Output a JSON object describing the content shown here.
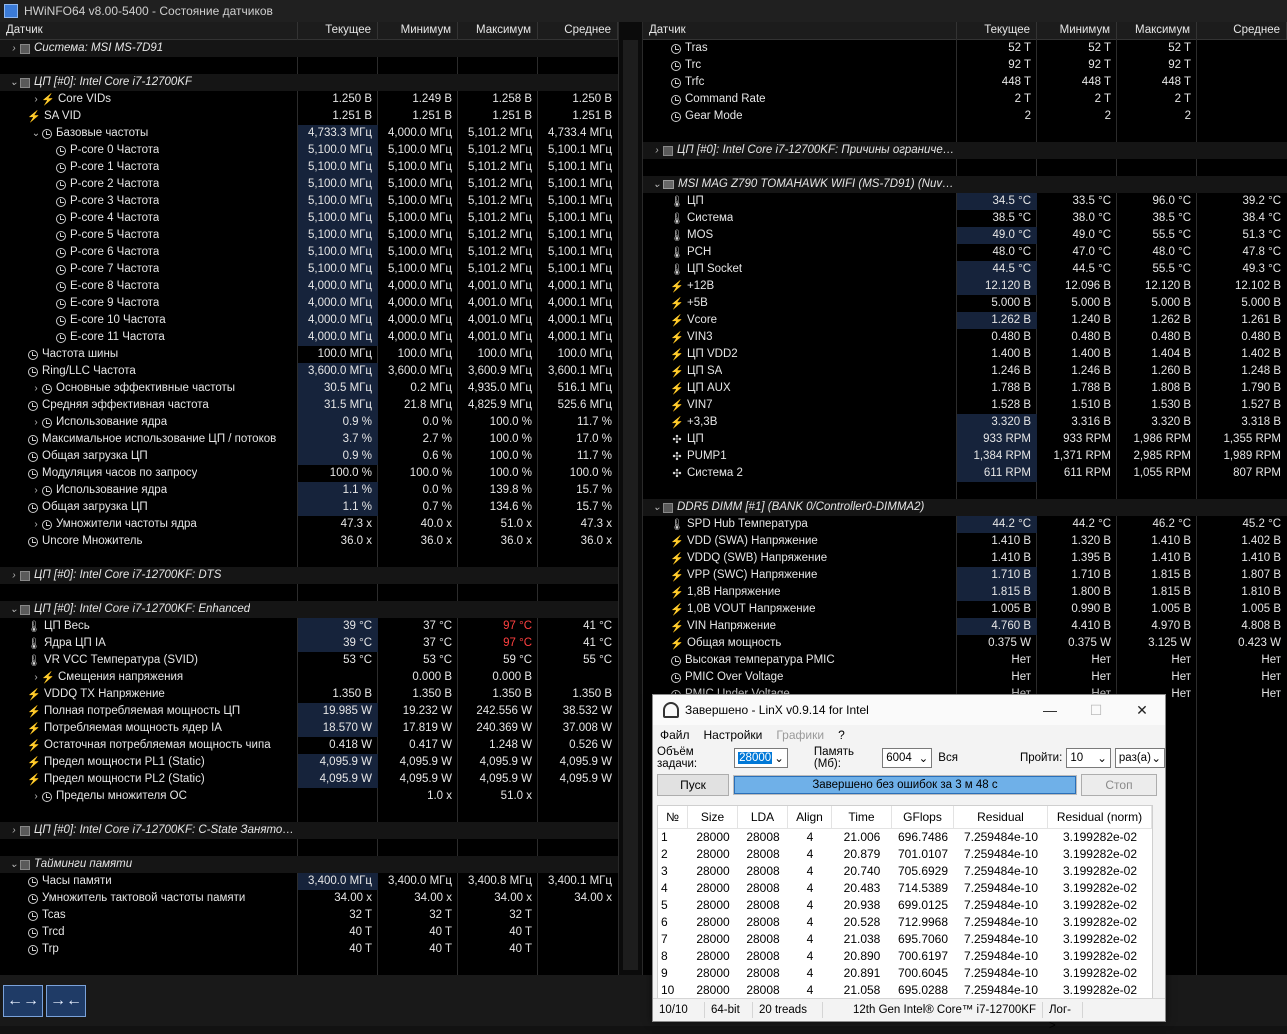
{
  "window_title": "HWiNFO64 v8.00-5400 - Состояние датчиков",
  "columns": {
    "sensor": "Датчик",
    "current": "Текущее",
    "min": "Минимум",
    "max": "Максимум",
    "avg": "Среднее"
  },
  "left_rows": [
    {
      "t": "g",
      "exp": "›",
      "icon": "chip",
      "name": "Система: MSI MS-7D91"
    },
    {
      "t": "s"
    },
    {
      "t": "g",
      "exp": "⌄",
      "icon": "chip",
      "name": "ЦП [#0]: Intel Core i7-12700KF"
    },
    {
      "t": "r",
      "ind": 1,
      "exp": "›",
      "icon": "bolt",
      "name": "Core VIDs",
      "cur": "1.250 В",
      "min": "1.249 В",
      "max": "1.258 В",
      "avg": "1.250 В"
    },
    {
      "t": "r",
      "ind": 0,
      "icon": "bolt",
      "name": "SA VID",
      "cur": "1.251 В",
      "min": "1.251 В",
      "max": "1.251 В",
      "avg": "1.251 В"
    },
    {
      "t": "r",
      "ind": 1,
      "exp": "⌄",
      "icon": "clock",
      "name": "Базовые частоты",
      "cur": "4,733.3 МГц",
      "min": "4,000.0 МГц",
      "max": "5,101.2 МГц",
      "avg": "4,733.4 МГц",
      "hl": true
    },
    {
      "t": "r",
      "ind": 2,
      "icon": "clock",
      "name": "P-core 0 Частота",
      "cur": "5,100.0 МГц",
      "min": "5,100.0 МГц",
      "max": "5,101.2 МГц",
      "avg": "5,100.1 МГц",
      "hl": true
    },
    {
      "t": "r",
      "ind": 2,
      "icon": "clock",
      "name": "P-core 1 Частота",
      "cur": "5,100.0 МГц",
      "min": "5,100.0 МГц",
      "max": "5,101.2 МГц",
      "avg": "5,100.1 МГц",
      "hl": true
    },
    {
      "t": "r",
      "ind": 2,
      "icon": "clock",
      "name": "P-core 2 Частота",
      "cur": "5,100.0 МГц",
      "min": "5,100.0 МГц",
      "max": "5,101.2 МГц",
      "avg": "5,100.1 МГц",
      "hl": true
    },
    {
      "t": "r",
      "ind": 2,
      "icon": "clock",
      "name": "P-core 3 Частота",
      "cur": "5,100.0 МГц",
      "min": "5,100.0 МГц",
      "max": "5,101.2 МГц",
      "avg": "5,100.1 МГц",
      "hl": true
    },
    {
      "t": "r",
      "ind": 2,
      "icon": "clock",
      "name": "P-core 4 Частота",
      "cur": "5,100.0 МГц",
      "min": "5,100.0 МГц",
      "max": "5,101.2 МГц",
      "avg": "5,100.1 МГц",
      "hl": true
    },
    {
      "t": "r",
      "ind": 2,
      "icon": "clock",
      "name": "P-core 5 Частота",
      "cur": "5,100.0 МГц",
      "min": "5,100.0 МГц",
      "max": "5,101.2 МГц",
      "avg": "5,100.1 МГц",
      "hl": true
    },
    {
      "t": "r",
      "ind": 2,
      "icon": "clock",
      "name": "P-core 6 Частота",
      "cur": "5,100.0 МГц",
      "min": "5,100.0 МГц",
      "max": "5,101.2 МГц",
      "avg": "5,100.1 МГц",
      "hl": true
    },
    {
      "t": "r",
      "ind": 2,
      "icon": "clock",
      "name": "P-core 7 Частота",
      "cur": "5,100.0 МГц",
      "min": "5,100.0 МГц",
      "max": "5,101.2 МГц",
      "avg": "5,100.1 МГц",
      "hl": true
    },
    {
      "t": "r",
      "ind": 2,
      "icon": "clock",
      "name": "E-core 8 Частота",
      "cur": "4,000.0 МГц",
      "min": "4,000.0 МГц",
      "max": "4,001.0 МГц",
      "avg": "4,000.1 МГц",
      "hl": true
    },
    {
      "t": "r",
      "ind": 2,
      "icon": "clock",
      "name": "E-core 9 Частота",
      "cur": "4,000.0 МГц",
      "min": "4,000.0 МГц",
      "max": "4,001.0 МГц",
      "avg": "4,000.1 МГц",
      "hl": true
    },
    {
      "t": "r",
      "ind": 2,
      "icon": "clock",
      "name": "E-core 10 Частота",
      "cur": "4,000.0 МГц",
      "min": "4,000.0 МГц",
      "max": "4,001.0 МГц",
      "avg": "4,000.1 МГц",
      "hl": true
    },
    {
      "t": "r",
      "ind": 2,
      "icon": "clock",
      "name": "E-core 11 Частота",
      "cur": "4,000.0 МГц",
      "min": "4,000.0 МГц",
      "max": "4,001.0 МГц",
      "avg": "4,000.1 МГц",
      "hl": true
    },
    {
      "t": "r",
      "ind": 0,
      "icon": "clock",
      "name": "Частота шины",
      "cur": "100.0 МГц",
      "min": "100.0 МГц",
      "max": "100.0 МГц",
      "avg": "100.0 МГц"
    },
    {
      "t": "r",
      "ind": 0,
      "icon": "clock",
      "name": "Ring/LLC Частота",
      "cur": "3,600.0 МГц",
      "min": "3,600.0 МГц",
      "max": "3,600.9 МГц",
      "avg": "3,600.1 МГц",
      "hl": true
    },
    {
      "t": "r",
      "ind": 1,
      "exp": "›",
      "icon": "clock",
      "name": "Основные эффективные частоты",
      "cur": "30.5 МГц",
      "min": "0.2 МГц",
      "max": "4,935.0 МГц",
      "avg": "516.1 МГц",
      "hl": true
    },
    {
      "t": "r",
      "ind": 0,
      "icon": "clock",
      "name": "Средняя эффективная частота",
      "cur": "31.5 МГц",
      "min": "21.8 МГц",
      "max": "4,825.9 МГц",
      "avg": "525.6 МГц",
      "hl": true
    },
    {
      "t": "r",
      "ind": 1,
      "exp": "›",
      "icon": "clock",
      "name": "Использование ядра",
      "cur": "0.9 %",
      "min": "0.0 %",
      "max": "100.0 %",
      "avg": "11.7 %",
      "hl": true
    },
    {
      "t": "r",
      "ind": 0,
      "icon": "clock",
      "name": "Максимальное использование ЦП / потоков",
      "cur": "3.7 %",
      "min": "2.7 %",
      "max": "100.0 %",
      "avg": "17.0 %",
      "hl": true
    },
    {
      "t": "r",
      "ind": 0,
      "icon": "clock",
      "name": "Общая загрузка ЦП",
      "cur": "0.9 %",
      "min": "0.6 %",
      "max": "100.0 %",
      "avg": "11.7 %",
      "hl": true
    },
    {
      "t": "r",
      "ind": 0,
      "icon": "clock",
      "name": "Модуляция часов по запросу",
      "cur": "100.0 %",
      "min": "100.0 %",
      "max": "100.0 %",
      "avg": "100.0 %"
    },
    {
      "t": "r",
      "ind": 1,
      "exp": "›",
      "icon": "clock",
      "name": "Использование ядра",
      "cur": "1.1 %",
      "min": "0.0 %",
      "max": "139.8 %",
      "avg": "15.7 %",
      "hl": true
    },
    {
      "t": "r",
      "ind": 0,
      "icon": "clock",
      "name": "Общая загрузка ЦП",
      "cur": "1.1 %",
      "min": "0.7 %",
      "max": "134.6 %",
      "avg": "15.7 %",
      "hl": true
    },
    {
      "t": "r",
      "ind": 1,
      "exp": "›",
      "icon": "clock",
      "name": "Умножители частоты ядра",
      "cur": "47.3 x",
      "min": "40.0 x",
      "max": "51.0 x",
      "avg": "47.3 x"
    },
    {
      "t": "r",
      "ind": 0,
      "icon": "clock",
      "name": "Uncore Множитель",
      "cur": "36.0 x",
      "min": "36.0 x",
      "max": "36.0 x",
      "avg": "36.0 x"
    },
    {
      "t": "s"
    },
    {
      "t": "g",
      "exp": "›",
      "icon": "chip",
      "name": "ЦП [#0]: Intel Core i7-12700KF: DTS"
    },
    {
      "t": "s"
    },
    {
      "t": "g",
      "exp": "⌄",
      "icon": "chip",
      "name": "ЦП [#0]: Intel Core i7-12700KF: Enhanced"
    },
    {
      "t": "r",
      "ind": 0,
      "icon": "therm",
      "name": "ЦП Весь",
      "cur": "39 °C",
      "min": "37 °C",
      "max": "97 °C",
      "avg": "41 °C",
      "hl": true,
      "redmax": true
    },
    {
      "t": "r",
      "ind": 0,
      "icon": "therm",
      "name": "Ядра ЦП IA",
      "cur": "39 °C",
      "min": "37 °C",
      "max": "97 °C",
      "avg": "41 °C",
      "hl": true,
      "redmax": true
    },
    {
      "t": "r",
      "ind": 0,
      "icon": "therm",
      "name": "VR VCC Температура (SVID)",
      "cur": "53 °C",
      "min": "53 °C",
      "max": "59 °C",
      "avg": "55 °C"
    },
    {
      "t": "r",
      "ind": 1,
      "exp": "›",
      "icon": "bolt",
      "name": "Смещения напряжения",
      "cur": "",
      "min": "0.000 В",
      "max": "0.000 В",
      "avg": ""
    },
    {
      "t": "r",
      "ind": 0,
      "icon": "bolt",
      "name": "VDDQ TX Напряжение",
      "cur": "1.350 В",
      "min": "1.350 В",
      "max": "1.350 В",
      "avg": "1.350 В"
    },
    {
      "t": "r",
      "ind": 0,
      "icon": "bolt",
      "name": "Полная потребляемая мощность ЦП",
      "cur": "19.985 W",
      "min": "19.232 W",
      "max": "242.556 W",
      "avg": "38.532 W",
      "hl": true
    },
    {
      "t": "r",
      "ind": 0,
      "icon": "bolt",
      "name": "Потребляемая мощность ядер IA",
      "cur": "18.570 W",
      "min": "17.819 W",
      "max": "240.369 W",
      "avg": "37.008 W",
      "hl": true
    },
    {
      "t": "r",
      "ind": 0,
      "icon": "bolt",
      "name": "Остаточная потребляемая мощность чипа",
      "cur": "0.418 W",
      "min": "0.417 W",
      "max": "1.248 W",
      "avg": "0.526 W"
    },
    {
      "t": "r",
      "ind": 0,
      "icon": "bolt",
      "name": "Предел мощности PL1 (Static)",
      "cur": "4,095.9 W",
      "min": "4,095.9 W",
      "max": "4,095.9 W",
      "avg": "4,095.9 W",
      "hl": true
    },
    {
      "t": "r",
      "ind": 0,
      "icon": "bolt",
      "name": "Предел мощности PL2 (Static)",
      "cur": "4,095.9 W",
      "min": "4,095.9 W",
      "max": "4,095.9 W",
      "avg": "4,095.9 W",
      "hl": true
    },
    {
      "t": "r",
      "ind": 1,
      "exp": "›",
      "icon": "clock",
      "name": "Пределы множителя ОС",
      "cur": "",
      "min": "1.0 x",
      "max": "51.0 x",
      "avg": ""
    },
    {
      "t": "s"
    },
    {
      "t": "g",
      "exp": "›",
      "icon": "chip",
      "name": "ЦП [#0]: Intel Core i7-12700KF: C-State Занятость"
    },
    {
      "t": "s"
    },
    {
      "t": "g",
      "exp": "⌄",
      "icon": "chip",
      "name": "Тайминги памяти"
    },
    {
      "t": "r",
      "ind": 0,
      "icon": "clock",
      "name": "Часы памяти",
      "cur": "3,400.0 МГц",
      "min": "3,400.0 МГц",
      "max": "3,400.8 МГц",
      "avg": "3,400.1 МГц",
      "hl": true
    },
    {
      "t": "r",
      "ind": 0,
      "icon": "clock",
      "name": "Умножитель тактовой частоты памяти",
      "cur": "34.00 x",
      "min": "34.00 x",
      "max": "34.00 x",
      "avg": "34.00 x"
    },
    {
      "t": "r",
      "ind": 0,
      "icon": "clock",
      "name": "Tcas",
      "cur": "32 T",
      "min": "32 T",
      "max": "32 T",
      "avg": ""
    },
    {
      "t": "r",
      "ind": 0,
      "icon": "clock",
      "name": "Trcd",
      "cur": "40 T",
      "min": "40 T",
      "max": "40 T",
      "avg": ""
    },
    {
      "t": "r",
      "ind": 0,
      "icon": "clock",
      "name": "Trp",
      "cur": "40 T",
      "min": "40 T",
      "max": "40 T",
      "avg": ""
    }
  ],
  "right_rows": [
    {
      "t": "r",
      "ind": 0,
      "icon": "clock",
      "name": "Tras",
      "cur": "52 T",
      "min": "52 T",
      "max": "52 T",
      "avg": ""
    },
    {
      "t": "r",
      "ind": 0,
      "icon": "clock",
      "name": "Trc",
      "cur": "92 T",
      "min": "92 T",
      "max": "92 T",
      "avg": ""
    },
    {
      "t": "r",
      "ind": 0,
      "icon": "clock",
      "name": "Trfc",
      "cur": "448 T",
      "min": "448 T",
      "max": "448 T",
      "avg": ""
    },
    {
      "t": "r",
      "ind": 0,
      "icon": "clock",
      "name": "Command Rate",
      "cur": "2 T",
      "min": "2 T",
      "max": "2 T",
      "avg": ""
    },
    {
      "t": "r",
      "ind": 0,
      "icon": "clock",
      "name": "Gear Mode",
      "cur": "2",
      "min": "2",
      "max": "2",
      "avg": ""
    },
    {
      "t": "s"
    },
    {
      "t": "g",
      "exp": "›",
      "icon": "chip",
      "name": "ЦП [#0]: Intel Core i7-12700KF: Причины ограничения производительности"
    },
    {
      "t": "s"
    },
    {
      "t": "g",
      "exp": "⌄",
      "icon": "mb",
      "name": "MSI MAG Z790 TOMAHAWK WIFI (MS-7D91) (Nuvoton NCT6687D)"
    },
    {
      "t": "r",
      "ind": 0,
      "icon": "therm",
      "name": "ЦП",
      "cur": "34.5 °C",
      "min": "33.5 °C",
      "max": "96.0 °C",
      "avg": "39.2 °C",
      "hl": true
    },
    {
      "t": "r",
      "ind": 0,
      "icon": "therm",
      "name": "Система",
      "cur": "38.5 °C",
      "min": "38.0 °C",
      "max": "38.5 °C",
      "avg": "38.4 °C"
    },
    {
      "t": "r",
      "ind": 0,
      "icon": "therm",
      "name": "MOS",
      "cur": "49.0 °C",
      "min": "49.0 °C",
      "max": "55.5 °C",
      "avg": "51.3 °C",
      "hl": true
    },
    {
      "t": "r",
      "ind": 0,
      "icon": "therm",
      "name": "PCH",
      "cur": "48.0 °C",
      "min": "47.0 °C",
      "max": "48.0 °C",
      "avg": "47.8 °C"
    },
    {
      "t": "r",
      "ind": 0,
      "icon": "therm",
      "name": "ЦП Socket",
      "cur": "44.5 °C",
      "min": "44.5 °C",
      "max": "55.5 °C",
      "avg": "49.3 °C",
      "hl": true
    },
    {
      "t": "r",
      "ind": 0,
      "icon": "bolt",
      "name": "+12В",
      "cur": "12.120 В",
      "min": "12.096 В",
      "max": "12.120 В",
      "avg": "12.102 В",
      "hl": true
    },
    {
      "t": "r",
      "ind": 0,
      "icon": "bolt",
      "name": "+5В",
      "cur": "5.000 В",
      "min": "5.000 В",
      "max": "5.000 В",
      "avg": "5.000 В"
    },
    {
      "t": "r",
      "ind": 0,
      "icon": "bolt",
      "name": "Vcore",
      "cur": "1.262 В",
      "min": "1.240 В",
      "max": "1.262 В",
      "avg": "1.261 В",
      "hl": true
    },
    {
      "t": "r",
      "ind": 0,
      "icon": "bolt",
      "name": "VIN3",
      "cur": "0.480 В",
      "min": "0.480 В",
      "max": "0.480 В",
      "avg": "0.480 В"
    },
    {
      "t": "r",
      "ind": 0,
      "icon": "bolt",
      "name": "ЦП VDD2",
      "cur": "1.400 В",
      "min": "1.400 В",
      "max": "1.404 В",
      "avg": "1.402 В"
    },
    {
      "t": "r",
      "ind": 0,
      "icon": "bolt",
      "name": "ЦП SA",
      "cur": "1.246 В",
      "min": "1.246 В",
      "max": "1.260 В",
      "avg": "1.248 В"
    },
    {
      "t": "r",
      "ind": 0,
      "icon": "bolt",
      "name": "ЦП AUX",
      "cur": "1.788 В",
      "min": "1.788 В",
      "max": "1.808 В",
      "avg": "1.790 В"
    },
    {
      "t": "r",
      "ind": 0,
      "icon": "bolt",
      "name": "VIN7",
      "cur": "1.528 В",
      "min": "1.510 В",
      "max": "1.530 В",
      "avg": "1.527 В"
    },
    {
      "t": "r",
      "ind": 0,
      "icon": "bolt",
      "name": "+3,3В",
      "cur": "3.320 В",
      "min": "3.316 В",
      "max": "3.320 В",
      "avg": "3.318 В",
      "hl": true
    },
    {
      "t": "r",
      "ind": 0,
      "icon": "fan",
      "name": "ЦП",
      "cur": "933 RPM",
      "min": "933 RPM",
      "max": "1,986 RPM",
      "avg": "1,355 RPM",
      "hl": true
    },
    {
      "t": "r",
      "ind": 0,
      "icon": "fan",
      "name": "PUMP1",
      "cur": "1,384 RPM",
      "min": "1,371 RPM",
      "max": "2,985 RPM",
      "avg": "1,989 RPM",
      "hl": true
    },
    {
      "t": "r",
      "ind": 0,
      "icon": "fan",
      "name": "Система 2",
      "cur": "611 RPM",
      "min": "611 RPM",
      "max": "1,055 RPM",
      "avg": "807 RPM",
      "hl": true
    },
    {
      "t": "s"
    },
    {
      "t": "g",
      "exp": "⌄",
      "icon": "chip",
      "name": "DDR5 DIMM [#1] (BANK 0/Controller0-DIMMA2)"
    },
    {
      "t": "r",
      "ind": 0,
      "icon": "therm",
      "name": "SPD Hub Температура",
      "cur": "44.2 °C",
      "min": "44.2 °C",
      "max": "46.2 °C",
      "avg": "45.2 °C",
      "hl": true
    },
    {
      "t": "r",
      "ind": 0,
      "icon": "bolt",
      "name": "VDD (SWA) Напряжение",
      "cur": "1.410 В",
      "min": "1.320 В",
      "max": "1.410 В",
      "avg": "1.402 В"
    },
    {
      "t": "r",
      "ind": 0,
      "icon": "bolt",
      "name": "VDDQ (SWB) Напряжение",
      "cur": "1.410 В",
      "min": "1.395 В",
      "max": "1.410 В",
      "avg": "1.410 В"
    },
    {
      "t": "r",
      "ind": 0,
      "icon": "bolt",
      "name": "VPP (SWC) Напряжение",
      "cur": "1.710 В",
      "min": "1.710 В",
      "max": "1.815 В",
      "avg": "1.807 В",
      "hl": true
    },
    {
      "t": "r",
      "ind": 0,
      "icon": "bolt",
      "name": "1,8В Напряжение",
      "cur": "1.815 В",
      "min": "1.800 В",
      "max": "1.815 В",
      "avg": "1.810 В",
      "hl": true
    },
    {
      "t": "r",
      "ind": 0,
      "icon": "bolt",
      "name": "1,0В VOUT Напряжение",
      "cur": "1.005 В",
      "min": "0.990 В",
      "max": "1.005 В",
      "avg": "1.005 В"
    },
    {
      "t": "r",
      "ind": 0,
      "icon": "bolt",
      "name": "VIN Напряжение",
      "cur": "4.760 В",
      "min": "4.410 В",
      "max": "4.970 В",
      "avg": "4.808 В",
      "hl": true
    },
    {
      "t": "r",
      "ind": 0,
      "icon": "bolt",
      "name": "Общая мощность",
      "cur": "0.375 W",
      "min": "0.375 W",
      "max": "3.125 W",
      "avg": "0.423 W"
    },
    {
      "t": "r",
      "ind": 0,
      "icon": "clock",
      "name": "Высокая температура PMIC",
      "cur": "Нет",
      "min": "Нет",
      "max": "Нет",
      "avg": "Нет"
    },
    {
      "t": "r",
      "ind": 0,
      "icon": "clock",
      "name": "PMIC Over Voltage",
      "cur": "Нет",
      "min": "Нет",
      "max": "Нет",
      "avg": "Нет"
    },
    {
      "t": "r",
      "ind": 0,
      "icon": "clock",
      "name": "PMIC Under Voltage",
      "cur": "Нет",
      "min": "Нет",
      "max": "Нет",
      "avg": "Нет"
    }
  ],
  "linx": {
    "title": "Завершено - LinX v0.9.14 for Intel",
    "menu": [
      "Файл",
      "Настройки",
      "Графики",
      "?"
    ],
    "problem_label": "Объём задачи:",
    "problem_value": "28000",
    "memory_label": "Память (Мб):",
    "memory_value": "6004",
    "all_label": "Вся",
    "passes_label": "Пройти:",
    "passes_value": "10",
    "times_value": "раз(а)",
    "start_label": "Пуск",
    "stop_label": "Стоп",
    "status_text": "Завершено без ошибок за 3 м 48 с",
    "progress": 1.0,
    "table_headers": [
      "№",
      "Size",
      "LDA",
      "Align",
      "Time",
      "GFlops",
      "Residual",
      "Residual (norm)"
    ],
    "table_rows": [
      [
        "1",
        "28000",
        "28008",
        "4",
        "21.006",
        "696.7486",
        "7.259484e-10",
        "3.199282e-02"
      ],
      [
        "2",
        "28000",
        "28008",
        "4",
        "20.879",
        "701.0107",
        "7.259484e-10",
        "3.199282e-02"
      ],
      [
        "3",
        "28000",
        "28008",
        "4",
        "20.740",
        "705.6929",
        "7.259484e-10",
        "3.199282e-02"
      ],
      [
        "4",
        "28000",
        "28008",
        "4",
        "20.483",
        "714.5389",
        "7.259484e-10",
        "3.199282e-02"
      ],
      [
        "5",
        "28000",
        "28008",
        "4",
        "20.938",
        "699.0125",
        "7.259484e-10",
        "3.199282e-02"
      ],
      [
        "6",
        "28000",
        "28008",
        "4",
        "20.528",
        "712.9968",
        "7.259484e-10",
        "3.199282e-02"
      ],
      [
        "7",
        "28000",
        "28008",
        "4",
        "21.038",
        "695.7060",
        "7.259484e-10",
        "3.199282e-02"
      ],
      [
        "8",
        "28000",
        "28008",
        "4",
        "20.890",
        "700.6197",
        "7.259484e-10",
        "3.199282e-02"
      ],
      [
        "9",
        "28000",
        "28008",
        "4",
        "20.891",
        "700.6045",
        "7.259484e-10",
        "3.199282e-02"
      ],
      [
        "10",
        "28000",
        "28008",
        "4",
        "21.058",
        "695.0288",
        "7.259484e-10",
        "3.199282e-02"
      ]
    ],
    "status_bar": [
      "10/10",
      "64-bit",
      "20 treads",
      "12th Gen Intel® Core™ i7-12700KF",
      "Лог->"
    ]
  },
  "bottom": {
    "nav_left_icon": "←→",
    "nav_right_icon": "→←"
  }
}
